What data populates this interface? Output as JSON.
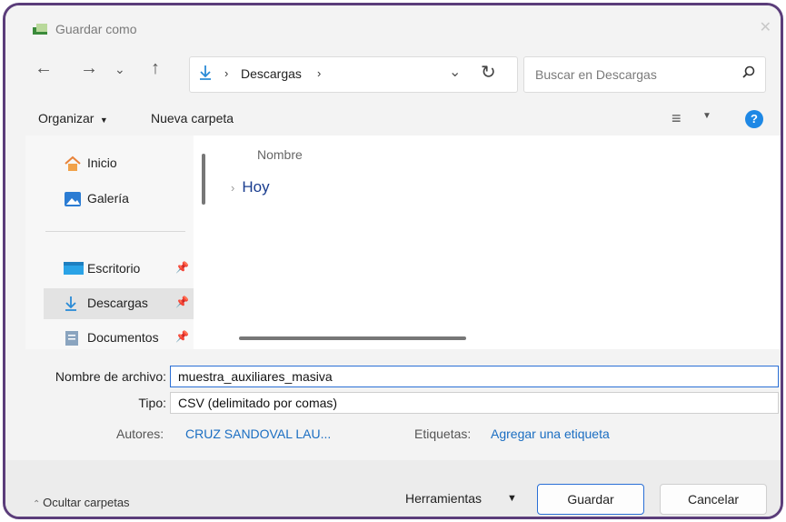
{
  "window": {
    "title": "Guardar como"
  },
  "nav": {
    "breadcrumb": "Descargas",
    "sep": "›",
    "search_placeholder": "Buscar en Descargas"
  },
  "toolbar": {
    "organize": "Organizar",
    "new_folder": "Nueva carpeta",
    "help": "?"
  },
  "sidebar": {
    "items": [
      {
        "label": "Inicio",
        "icon": "home-icon"
      },
      {
        "label": "Galería",
        "icon": "gallery-icon"
      },
      {
        "label": "Escritorio",
        "icon": "desktop-icon",
        "pinned": true
      },
      {
        "label": "Descargas",
        "icon": "download-icon",
        "pinned": true,
        "selected": true
      },
      {
        "label": "Documentos",
        "icon": "documents-icon",
        "pinned": true
      }
    ]
  },
  "file_list": {
    "column_header": "Nombre",
    "groups": [
      "Hoy"
    ]
  },
  "form": {
    "filename_label": "Nombre de archivo:",
    "filename_value": "muestra_auxiliares_masiva",
    "type_label": "Tipo:",
    "type_value": "CSV (delimitado por comas)",
    "authors_label": "Autores:",
    "authors_value": "CRUZ SANDOVAL LAU...",
    "tags_label": "Etiquetas:",
    "tags_value": "Agregar una etiqueta"
  },
  "footer": {
    "hide_folders": "Ocultar carpetas",
    "tools": "Herramientas",
    "save": "Guardar",
    "cancel": "Cancelar"
  },
  "colors": {
    "accent": "#2a6fd6",
    "link": "#1b6ec2",
    "frame": "#5b3d7a"
  }
}
